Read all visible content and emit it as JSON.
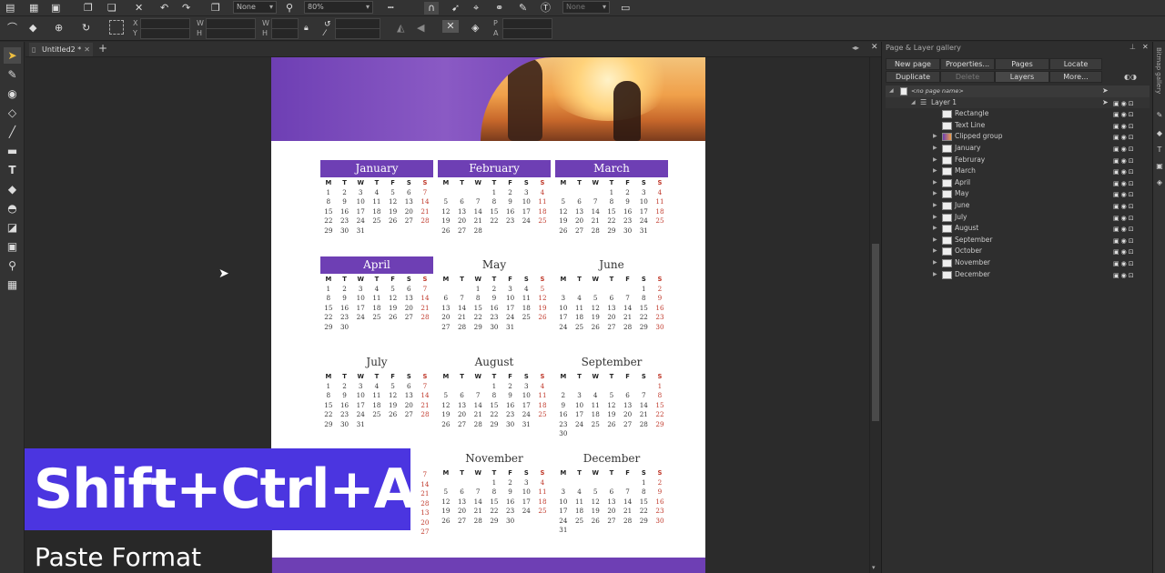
{
  "toolbar": {
    "combo_none_1": "None",
    "combo_zoom": "80%",
    "combo_none_2": "None",
    "labels": {
      "x": "X",
      "y": "Y",
      "w": "W",
      "h": "H",
      "w2": "W",
      "h2": "H",
      "p": "P",
      "a": "A"
    }
  },
  "document_tab": {
    "title": "Untitled2 *"
  },
  "calendar": {
    "dow": [
      "M",
      "T",
      "W",
      "T",
      "F",
      "S",
      "S"
    ],
    "months": [
      {
        "name": "January",
        "filled": true,
        "days": [
          "1",
          "2",
          "3",
          "4",
          "5",
          "6",
          "7",
          "8",
          "9",
          "10",
          "11",
          "12",
          "13",
          "14",
          "15",
          "16",
          "17",
          "18",
          "19",
          "20",
          "21",
          "22",
          "23",
          "24",
          "25",
          "26",
          "27",
          "28",
          "29",
          "30",
          "31"
        ],
        "offset": 0
      },
      {
        "name": "February",
        "filled": true,
        "days": [
          "1",
          "2",
          "3",
          "4",
          "5",
          "6",
          "7",
          "8",
          "9",
          "10",
          "11",
          "12",
          "13",
          "14",
          "15",
          "16",
          "17",
          "18",
          "19",
          "20",
          "21",
          "22",
          "23",
          "24",
          "25",
          "26",
          "27",
          "28"
        ],
        "offset": 3
      },
      {
        "name": "March",
        "filled": true,
        "days": [
          "1",
          "2",
          "3",
          "4",
          "5",
          "6",
          "7",
          "8",
          "9",
          "10",
          "11",
          "12",
          "13",
          "14",
          "15",
          "16",
          "17",
          "18",
          "19",
          "20",
          "21",
          "22",
          "23",
          "24",
          "25",
          "26",
          "27",
          "28",
          "29",
          "30",
          "31"
        ],
        "offset": 3
      },
      {
        "name": "April",
        "filled": true,
        "days": [
          "1",
          "2",
          "3",
          "4",
          "5",
          "6",
          "7",
          "8",
          "9",
          "10",
          "11",
          "12",
          "13",
          "14",
          "15",
          "16",
          "17",
          "18",
          "19",
          "20",
          "21",
          "22",
          "23",
          "24",
          "25",
          "26",
          "27",
          "28",
          "29",
          "30"
        ],
        "offset": 0
      },
      {
        "name": "May",
        "filled": false,
        "days": [
          "1",
          "2",
          "3",
          "4",
          "5",
          "6",
          "7",
          "8",
          "9",
          "10",
          "11",
          "12",
          "13",
          "14",
          "15",
          "16",
          "17",
          "18",
          "19",
          "20",
          "21",
          "22",
          "23",
          "24",
          "25",
          "26",
          "27",
          "28",
          "29",
          "30",
          "31"
        ],
        "offset": 2
      },
      {
        "name": "June",
        "filled": false,
        "days": [
          "1",
          "2",
          "3",
          "4",
          "5",
          "6",
          "7",
          "8",
          "9",
          "10",
          "11",
          "12",
          "13",
          "14",
          "15",
          "16",
          "17",
          "18",
          "19",
          "20",
          "21",
          "22",
          "23",
          "24",
          "25",
          "26",
          "27",
          "28",
          "29",
          "30"
        ],
        "offset": 5
      },
      {
        "name": "July",
        "filled": false,
        "days": [
          "1",
          "2",
          "3",
          "4",
          "5",
          "6",
          "7",
          "8",
          "9",
          "10",
          "11",
          "12",
          "13",
          "14",
          "15",
          "16",
          "17",
          "18",
          "19",
          "20",
          "21",
          "22",
          "23",
          "24",
          "25",
          "26",
          "27",
          "28",
          "29",
          "30",
          "31"
        ],
        "offset": 0
      },
      {
        "name": "August",
        "filled": false,
        "days": [
          "1",
          "2",
          "3",
          "4",
          "5",
          "6",
          "7",
          "8",
          "9",
          "10",
          "11",
          "12",
          "13",
          "14",
          "15",
          "16",
          "17",
          "18",
          "19",
          "20",
          "21",
          "22",
          "23",
          "24",
          "25",
          "26",
          "27",
          "28",
          "29",
          "30",
          "31"
        ],
        "offset": 3
      },
      {
        "name": "September",
        "filled": false,
        "days": [
          "1",
          "2",
          "3",
          "4",
          "5",
          "6",
          "7",
          "8",
          "9",
          "10",
          "11",
          "12",
          "13",
          "14",
          "15",
          "16",
          "17",
          "18",
          "19",
          "20",
          "21",
          "22",
          "23",
          "24",
          "25",
          "26",
          "27",
          "28",
          "29",
          "30"
        ],
        "offset": 6
      },
      {
        "name": "November",
        "filled": false,
        "days": [
          "1",
          "2",
          "3",
          "4",
          "5",
          "6",
          "7",
          "8",
          "9",
          "10",
          "11",
          "12",
          "13",
          "14",
          "15",
          "16",
          "17",
          "18",
          "19",
          "20",
          "21",
          "22",
          "23",
          "24",
          "25",
          "26",
          "27",
          "28",
          "29",
          "30"
        ],
        "offset": 3
      },
      {
        "name": "December",
        "filled": false,
        "days": [
          "1",
          "2",
          "3",
          "4",
          "5",
          "6",
          "7",
          "8",
          "9",
          "10",
          "11",
          "12",
          "13",
          "14",
          "15",
          "16",
          "17",
          "18",
          "19",
          "20",
          "21",
          "22",
          "23",
          "24",
          "25",
          "26",
          "27",
          "28",
          "29",
          "30",
          "31"
        ],
        "offset": 5
      }
    ],
    "october_partial": [
      "7",
      "14",
      "21",
      "28",
      "",
      "13",
      "20",
      "27"
    ]
  },
  "panel": {
    "title": "Page & Layer gallery",
    "buttons": {
      "new_page": "New page",
      "properties": "Properties...",
      "pages": "Pages",
      "locate": "Locate",
      "duplicate": "Duplicate",
      "delete": "Delete",
      "layers": "Layers",
      "more": "More..."
    },
    "page_name": "<no page name>",
    "layer": "Layer 1",
    "items": [
      "Rectangle",
      "Text Line",
      "Clipped group",
      "January",
      "Februray",
      "March",
      "April",
      "May",
      "June",
      "July",
      "August",
      "September",
      "October",
      "November",
      "December"
    ],
    "gallery_label": "Bitmap gallery"
  },
  "overlay": {
    "shortcut": "Shift+Ctrl+A",
    "caption": "Paste Format"
  },
  "colors": {
    "accent": "#6e3fb4",
    "overlay": "#4b35e0",
    "weekend_red": "#c0392b"
  }
}
